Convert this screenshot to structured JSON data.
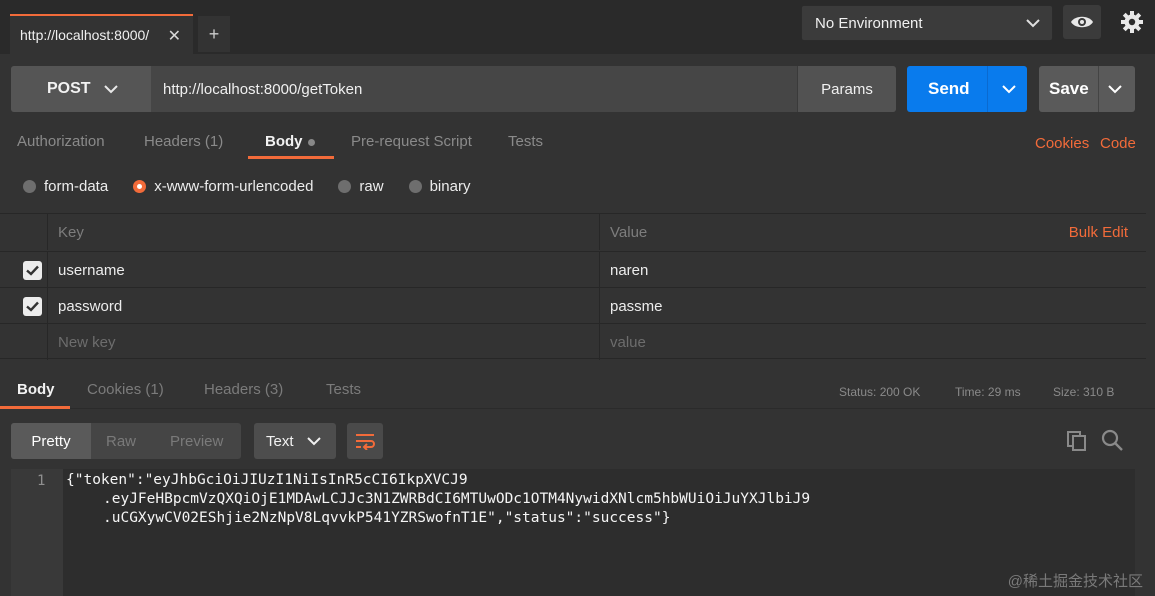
{
  "tabs": {
    "active_tab": "http://localhost:8000/",
    "close_glyph": "✕",
    "add_glyph": "+"
  },
  "environment": {
    "selected": "No Environment"
  },
  "request": {
    "method": "POST",
    "url": "http://localhost:8000/getToken",
    "params_label": "Params",
    "send_label": "Send",
    "save_label": "Save"
  },
  "request_tabs": {
    "authorization": "Authorization",
    "headers": "Headers (1)",
    "body": "Body",
    "pre_request": "Pre-request Script",
    "tests": "Tests",
    "cookies": "Cookies",
    "code": "Code"
  },
  "body_types": {
    "form_data": "form-data",
    "urlencoded": "x-www-form-urlencoded",
    "raw": "raw",
    "binary": "binary"
  },
  "kv_table": {
    "key_header": "Key",
    "value_header": "Value",
    "bulk_edit": "Bulk Edit",
    "rows": [
      {
        "key": "username",
        "value": "naren"
      },
      {
        "key": "password",
        "value": "passme"
      }
    ],
    "new_key_placeholder": "New key",
    "new_value_placeholder": "value"
  },
  "response_tabs": {
    "body": "Body",
    "cookies": "Cookies (1)",
    "headers": "Headers (3)",
    "tests": "Tests"
  },
  "status": {
    "status": "Status: 200 OK",
    "time": "Time: 29 ms",
    "size": "Size: 310 B"
  },
  "response_view": {
    "pretty": "Pretty",
    "raw": "Raw",
    "preview": "Preview",
    "format": "Text"
  },
  "response_body": {
    "line_number": "1",
    "line1": "{\"token\":\"eyJhbGciOiJIUzI1NiIsInR5cCI6IkpXVCJ9",
    "line2": ".eyJFeHBpcmVzQXQiOjE1MDAwLCJJc3N1ZWRBdCI6MTUwODc1OTM4NywidXNlcm5hbWUiOiJuYXJlbiJ9",
    "line3": ".uCGXywCV02EShjie2NzNpV8LqvvkP541YZRSwofnT1E\",\"status\":\"success\"}"
  },
  "watermark": "@稀土掘金技术社区",
  "colors": {
    "accent": "#f26b3a",
    "send_blue": "#097bed",
    "background": "#333333"
  }
}
